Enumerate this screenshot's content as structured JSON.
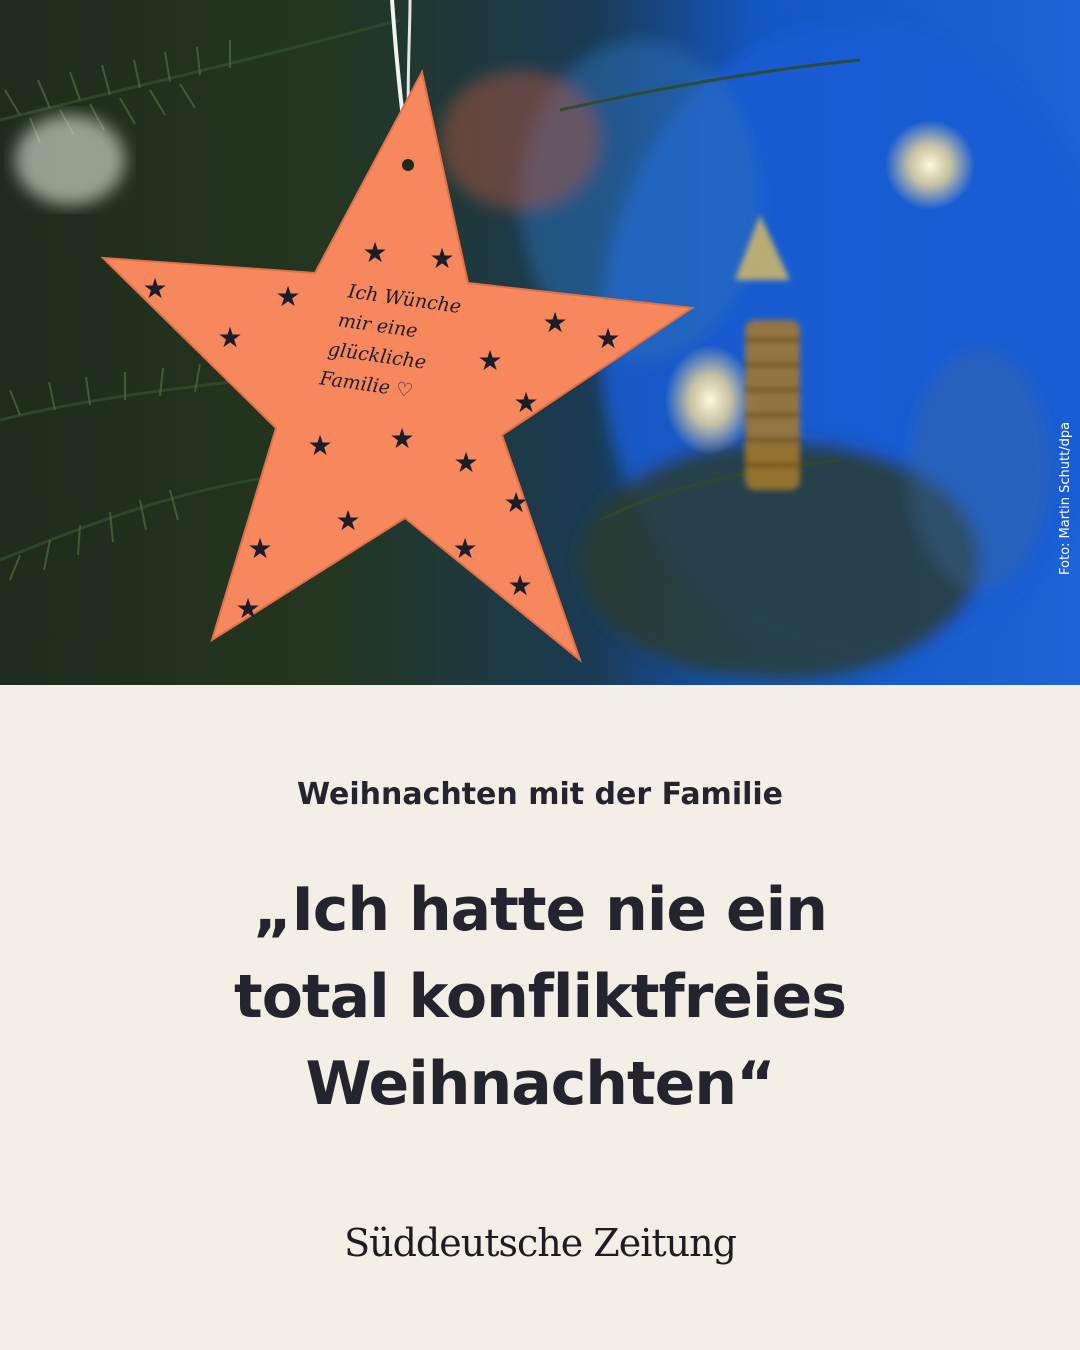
{
  "photo": {
    "credit": "Foto: Martin Schutt/dpa",
    "ornament_text": [
      "Ich Wünche",
      "mir eine",
      "glückliche",
      "Familie ♡"
    ]
  },
  "kicker": "Weihnachten mit der Familie",
  "headline": [
    "„Ich hatte nie ein",
    "total konfliktfreies",
    "Weihnachten“"
  ],
  "brand": "Süddeutsche Zeitung",
  "colors": {
    "background": "#f3efe6",
    "text": "#24242f",
    "star": "#f7875d"
  }
}
